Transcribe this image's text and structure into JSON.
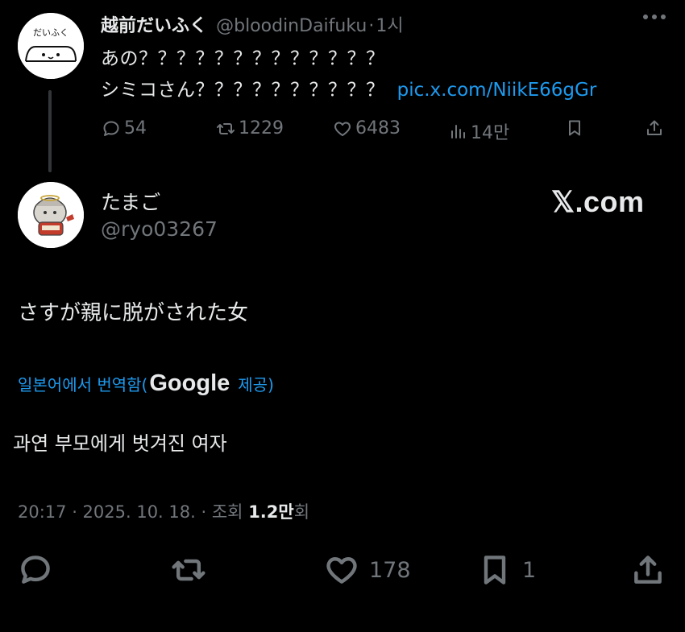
{
  "parent_tweet": {
    "display_name": "越前だいふく",
    "handle": "@bloodinDaifuku",
    "separator": "·",
    "time": "1시",
    "avatar_text": "だいふく",
    "line1": "あの？？？？？？？？？？？？？",
    "line2": "シミコさん？？？？？？？？？？",
    "link": "pic.x.com/NiikE66gGr",
    "replies": "54",
    "retweets": "1229",
    "likes": "6483",
    "views": "14만"
  },
  "main_tweet": {
    "display_name": "たまご",
    "handle": "@ryo03267",
    "watermark": "𝕏.com",
    "text": "さすが親に脱がされた女",
    "translation_prefix": "일본어에서 번역함(",
    "translation_brand": "Google",
    "translation_suffix": "제공)",
    "translated_text": "과연 부모에게 벗겨진 여자",
    "timestamp": "20:17 · 2025. 10. 18. ·",
    "views_label": "조회",
    "views_number": "1.2",
    "views_unit_bold": "만",
    "views_unit": "회",
    "likes": "178",
    "bookmarks": "1"
  }
}
